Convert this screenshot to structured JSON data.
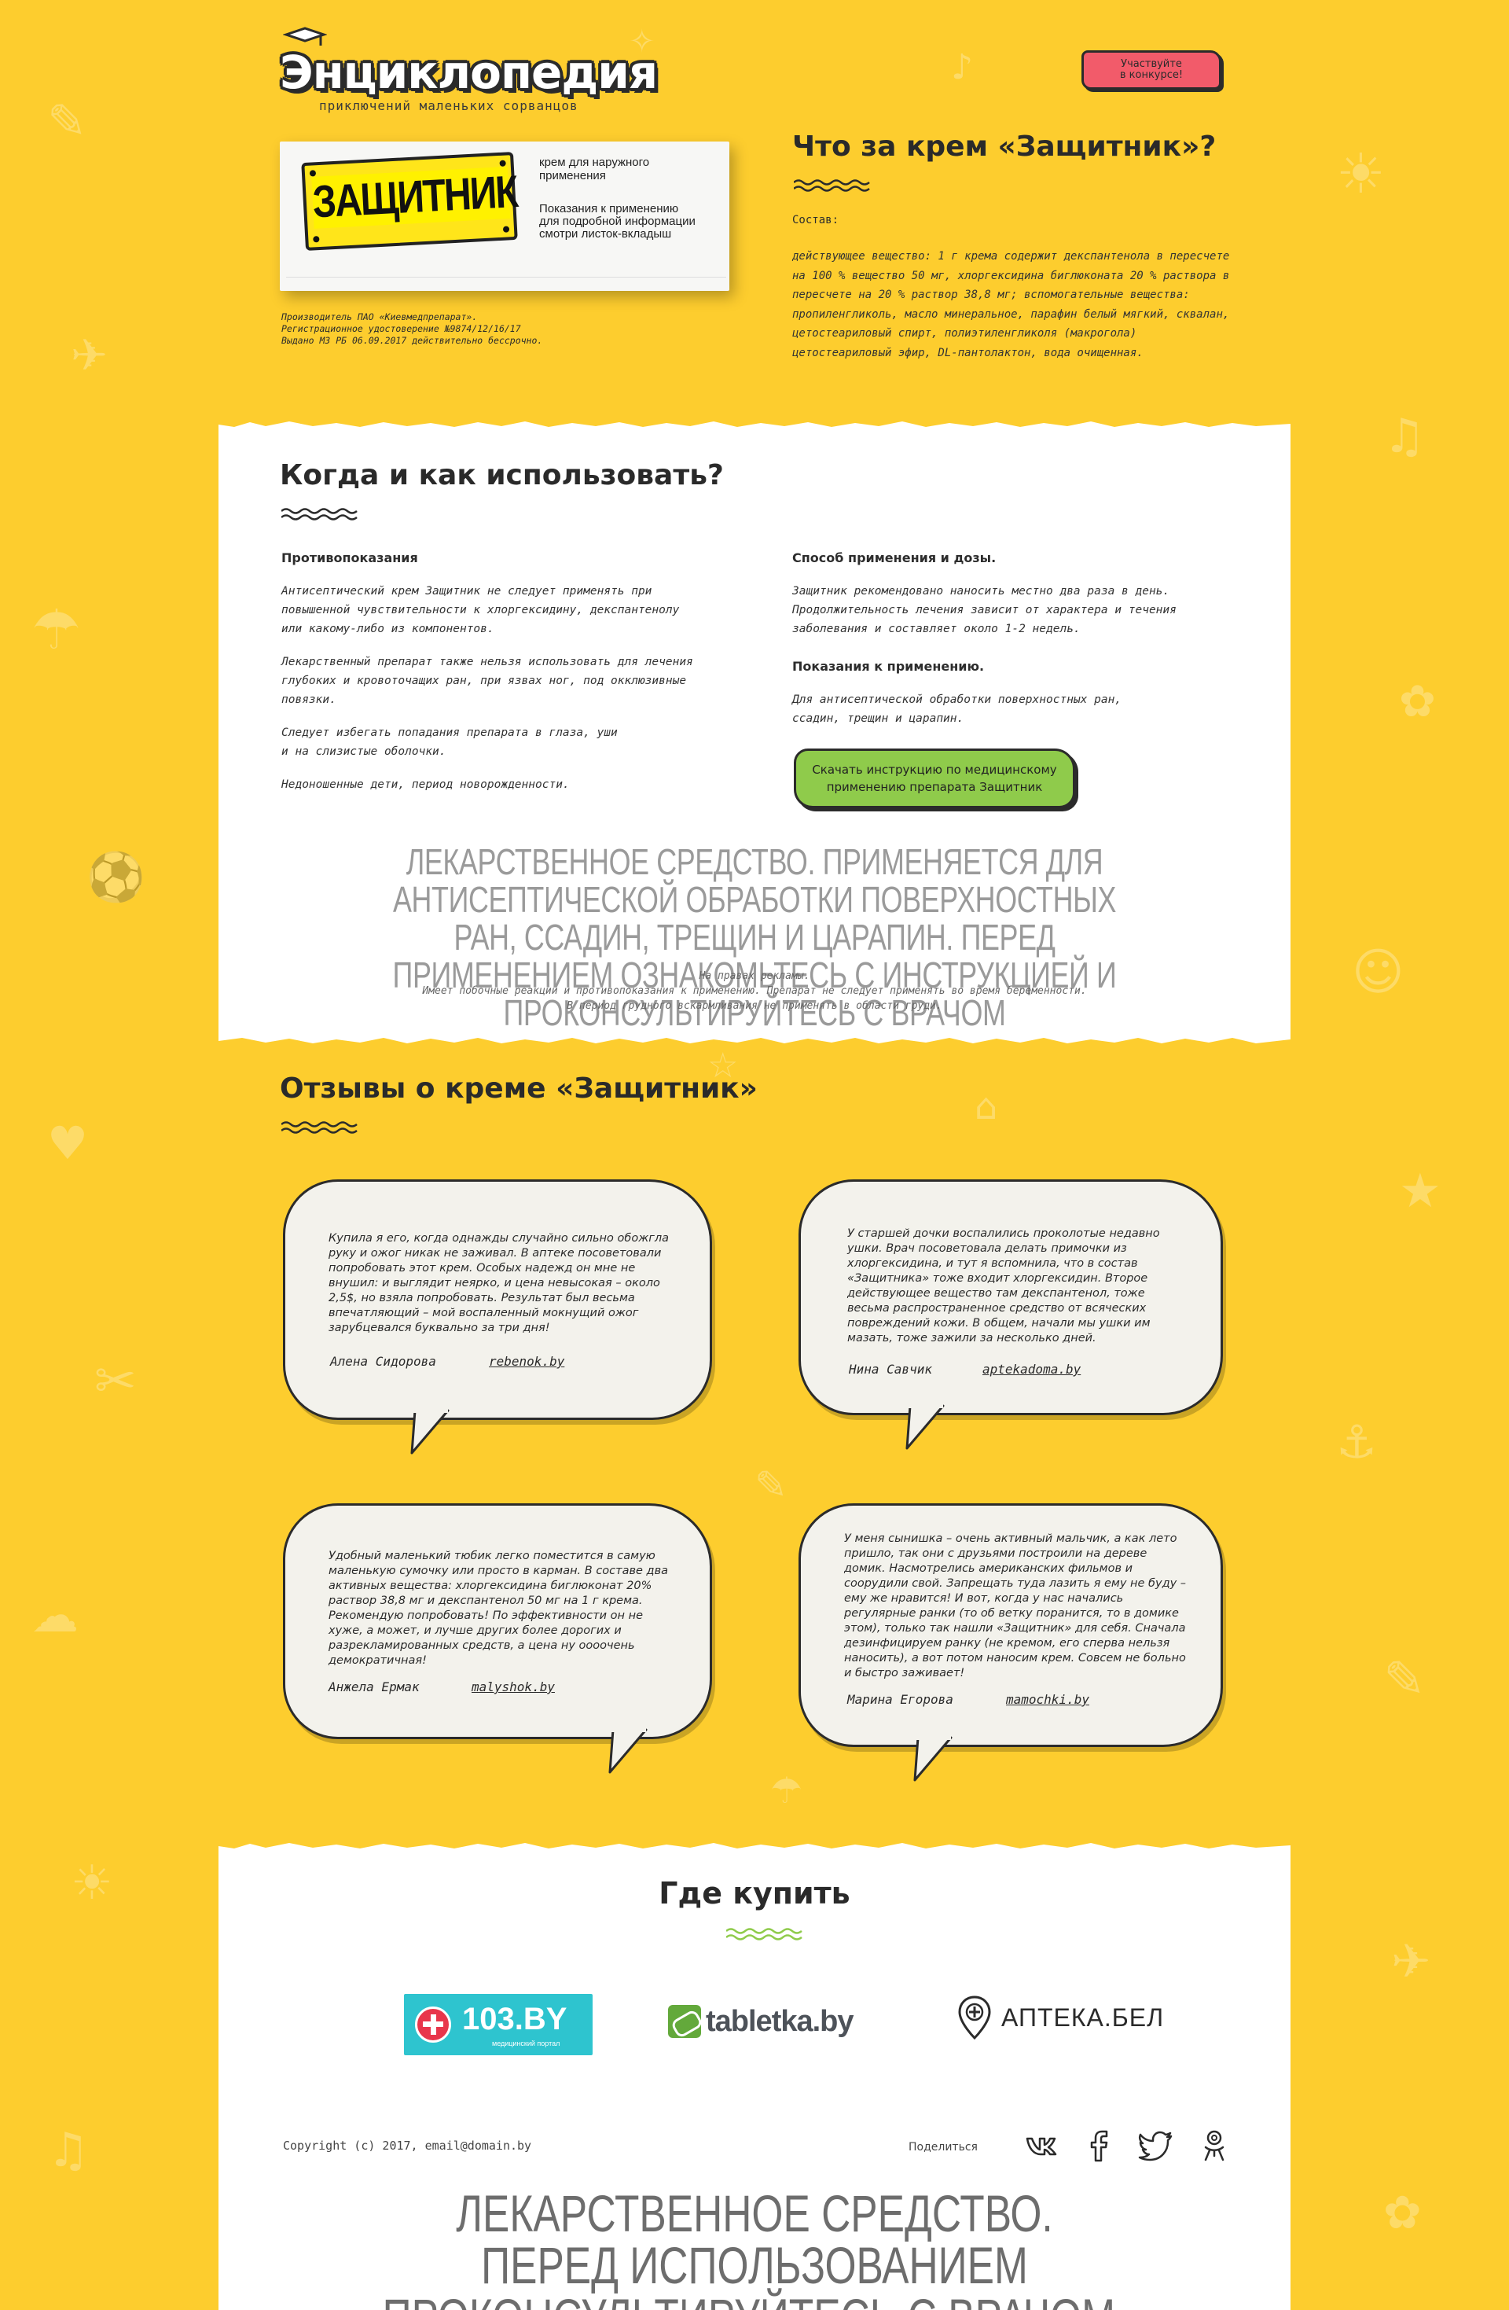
{
  "header": {
    "logo_title": "Энциклопедия",
    "logo_subtitle": "приключений маленьких сорванцов",
    "contest_button": "Участвуйте\nв конкурсе!"
  },
  "product": {
    "brand": "ЗАЩИТНИК",
    "box_top_text": "крем для наружного применения",
    "box_indications_title": "Показания к применению",
    "box_indications_text": "для подробной информации смотри листок-вкладыш",
    "manufacturer": "Производитель ПАО «Киевмедпрепарат».\nРегистрационное удостоверение №9874/12/16/17\nВыдано МЗ РБ 06.09.2017 действительно бессрочно."
  },
  "composition": {
    "title": "Что за крем  «Защитник»?",
    "label": "Состав:",
    "text": "действующее вещество: 1 г крема содержит декспантенола в пересчете на 100 % вещество  50 мг, хлоргексидина биглюконата 20 % раствора в пересчете на 20 % раствор 38,8 мг; вспомогательные вещества: пропиленгликоль, масло минеральное, парафин белый мягкий, сквалан, цетостеариловый спирт, полиэтиленгликоля (макрогола) цетостеариловый эфир, DL-пантолактон, вода очищенная."
  },
  "usage": {
    "title": "Когда и как использовать?",
    "contra_title": "Противопоказания",
    "contra_p1": "Антисептический крем Защитник не следует применять при\nповышенной чувствительности к хлоргексидину, декспантенолу\nили какому-либо из компонентов.",
    "contra_p2": "Лекарственный препарат также нельзя использовать для лечения\nглубоких  и кровоточащих ран, при язвах ног, под окклюзивные\nповязки.",
    "contra_p3": "Следует избегать попадания препарата в глаза, уши\nи на слизистые оболочки.",
    "contra_p4": "Недоношенные дети, период новорожденности.",
    "dose_title": "Способ применения и дозы.",
    "dose_text": "Защитник рекомендовано наносить местно два раза в день.\nПродолжительность лечения зависит от характера и течения\nзаболевания и составляет около 1-2 недель.",
    "ind_title": "Показания к применению.",
    "ind_text": "Для антисептической обработки поверхностных ран,\nссадин, трещин и царапин.",
    "download_button": "Скачать инструкцию по медицинскому\nприменению препарата Защитник",
    "disclaimer": "ЛЕКАРСТВЕННОЕ СРЕДСТВО. ПРИМЕНЯЕТСЯ ДЛЯ АНТИСЕПТИЧЕСКОЙ ОБРАБОТКИ ПОВЕРХНОСТНЫХ РАН, ССАДИН, ТРЕЩИН И ЦАРАПИН. ПЕРЕД ПРИМЕНЕНИЕМ ОЗНАКОМЬТЕСЬ С ИНСТРУКЦИЕЙ И ПРОКОНСУЛЬТИРУЙТЕСЬ С ВРАЧОМ",
    "ad_note": "На правах рекламы.\nИмеет побочные реакции и противопоказания к применению. Препарат не следует применять во время беременности.\nВ период грудного вскармливания не применять в области груди."
  },
  "reviews": {
    "title": "Отзывы о креме «Защитник»",
    "items": [
      {
        "text": "Купила я его, когда однажды случайно сильно обожгла руку и ожог никак не заживал. В аптеке посоветовали попробовать этот крем. Особых надежд он мне не внушил: и выглядит неярко, и цена невысокая – около 2,5$, но взяла попробовать. Результат был весьма впечатляющий – мой воспаленный мокнущий ожог зарубцевался буквально за три дня!",
        "author": "Алена Сидорова",
        "source": "rebenok.by"
      },
      {
        "text": "У старшей дочки воспалились проколотые недавно ушки. Врач посоветовала делать примочки из хлоргексидина, и тут я вспомнила, что в состав «Защитника» тоже входит хлоргексидин. Второе действующее вещество там декспантенол, тоже весьма распространенное средство от всяческих повреждений кожи. В общем, начали мы ушки им мазать, тоже зажили за несколько дней.",
        "author": "Нина Савчик",
        "source": "aptekadoma.by"
      },
      {
        "text": "Удобный маленький тюбик легко поместится в самую маленькую сумочку или просто в карман. В составе два активных вещества: хлоргексидина биглюконат 20% раствор 38,8 мг и декспантенол 50 мг на 1 г крема. Рекомендую попробовать! По эффективности он не хуже, а может, и лучше других более дорогих и разрекламированных средств, а цена ну оооочень демократичная!",
        "author": "Анжела Ермак",
        "source": "malyshok.by"
      },
      {
        "text": "У меня сынишка – очень активный мальчик, а как лето пришло, так они с друзьями построили на дереве домик. Насмотрелись американских фильмов и соорудили свой. Запрещать туда лазить я ему не буду – ему же нравится! И вот, когда у нас начались регулярные ранки (то об ветку поранится, то в домике этом), только так нашли «Защитник» для себя. Сначала дезинфицируем ранку (не кремом, его сперва нельзя наносить), а вот потом наносим крем. Совсем не больно и быстро заживает!",
        "author": "Марина Егорова",
        "source": "mamochki.by"
      }
    ]
  },
  "buy": {
    "title": "Где купить",
    "shops": [
      {
        "name": "103.BY",
        "sub": "медицинский портал"
      },
      {
        "name": "tabletka.by"
      },
      {
        "name": "АПТЕКА.БЕЛ"
      }
    ]
  },
  "footer": {
    "copyright": "Copyright (c) 2017, email@domain.by",
    "share_label": "Поделиться",
    "social": [
      "vk-icon",
      "facebook-icon",
      "twitter-icon",
      "odnoklassniki-icon"
    ],
    "disclaimer_line1": "ЛЕКАРСТВЕННОЕ СРЕДСТВО.",
    "disclaimer_line2": "ПЕРЕД ИСПОЛЬЗОВАНИЕМ ПРОКОНСУЛЬТИРУЙТЕСЬ С ВРАЧОМ."
  },
  "colors": {
    "background": "#fdcd2e",
    "contest_button": "#f25b6a",
    "download_button": "#8fcb4b",
    "bubble": "#f3f2ec",
    "text": "#2b2b2b"
  }
}
